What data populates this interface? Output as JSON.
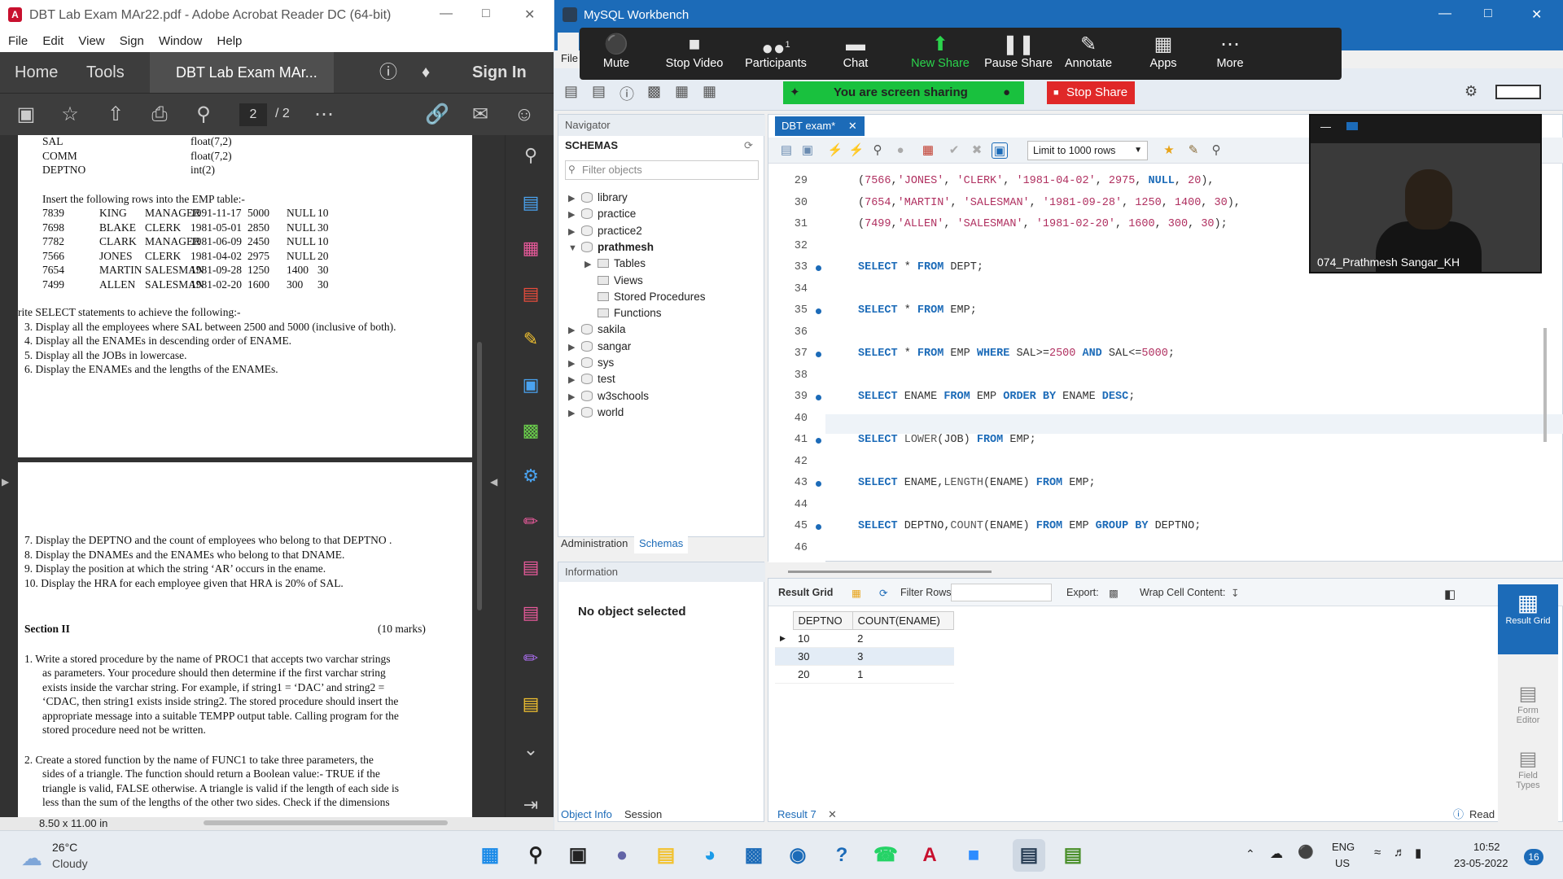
{
  "acrobat": {
    "title": "DBT Lab Exam MAr22.pdf - Adobe Acrobat Reader DC (64-bit)",
    "menu": [
      "File",
      "Edit",
      "View",
      "Sign",
      "Window",
      "Help"
    ],
    "home_tab": "Home",
    "tools_tab": "Tools",
    "doc_tab": "DBT Lab Exam MAr...",
    "sign_in": "Sign In",
    "page_current": "2",
    "page_total": "/ 2",
    "page_size": "8.50 x 11.00 in",
    "page1_fields": [
      {
        "name": "SAL",
        "type": "float(7,2)"
      },
      {
        "name": "COMM",
        "type": "float(7,2)"
      },
      {
        "name": "DEPTNO",
        "type": "int(2)"
      }
    ],
    "insert_heading": "Insert the following rows into the EMP table:-",
    "emp_rows": [
      [
        "7839",
        "KING",
        "MANAGER",
        "1991-11-17",
        "5000",
        "NULL",
        "10"
      ],
      [
        "7698",
        "BLAKE",
        "CLERK",
        "1981-05-01",
        "2850",
        "NULL",
        "30"
      ],
      [
        "7782",
        "CLARK",
        "MANAGER",
        "1981-06-09",
        "2450",
        "NULL",
        "10"
      ],
      [
        "7566",
        "JONES",
        "CLERK",
        "1981-04-02",
        "2975",
        "NULL",
        "20"
      ],
      [
        "7654",
        "MARTIN",
        "SALESMAN",
        "1981-09-28",
        "1250",
        "1400",
        "30"
      ],
      [
        "7499",
        "ALLEN",
        "SALESMAN",
        "1981-02-20",
        "1600",
        "300",
        "30"
      ]
    ],
    "select_heading": "rite SELECT statements to achieve the following:-",
    "questions_a": [
      "3.  Display all the employees where SAL between 2500 and 5000 (inclusive of both).",
      "4.  Display all the ENAMEs in descending order of ENAME.",
      "5.  Display all the JOBs in lowercase.",
      "6.  Display the ENAMEs and the lengths of the ENAMEs."
    ],
    "questions_b": [
      "7.  Display the DEPTNO and the count of employees who belong to that DEPTNO .",
      "8.  Display the DNAMEs and the ENAMEs who belong to that DNAME.",
      "9.  Display the position at which the string ‘AR’ occurs in the ename.",
      "10. Display the HRA for each employee given that HRA is 20% of SAL."
    ],
    "section_title": "Section II",
    "section_marks": "(10 marks)",
    "q1_lines": [
      "1.  Write a stored procedure by the name of PROC1 that accepts two varchar strings",
      "as parameters. Your procedure should then determine if the first varchar string",
      "exists inside the varchar string. For example, if string1 = ‘DAC’ and string2 =",
      "‘CDAC, then string1 exists inside string2.  The stored procedure should insert the",
      "appropriate message into a suitable TEMPP output table. Calling program for the",
      "stored procedure need not be written."
    ],
    "q2_lines": [
      "2.  Create a stored function by the name of FUNC1 to take three parameters, the",
      "sides of a triangle. The function should return a Boolean value:- TRUE if the",
      "triangle is valid, FALSE otherwise. A triangle is valid if the length of each side is",
      "less than the sum of the lengths of the other two sides. Check if the dimensions"
    ]
  },
  "workbench": {
    "title": "MySQL Workbench",
    "file_menu": "File",
    "navigator_label": "Navigator",
    "schemas_label": "SCHEMAS",
    "filter_placeholder": "Filter objects",
    "schemas_top": [
      "library",
      "practice",
      "practice2"
    ],
    "active_schema": "prathmesh",
    "active_children": [
      "Tables",
      "Views",
      "Stored Procedures",
      "Functions"
    ],
    "schemas_bottom": [
      "sakila",
      "sangar",
      "sys",
      "test",
      "w3schools",
      "world"
    ],
    "admin_tab": "Administration",
    "schemas_tab": "Schemas",
    "info_label": "Information",
    "no_object": "No object selected",
    "object_info_tab": "Object Info",
    "session_tab": "Session",
    "editor_tab": "DBT exam*",
    "limit_rows": "Limit to 1000 rows",
    "line_numbers": [
      "29",
      "30",
      "31",
      "32",
      "33",
      "34",
      "35",
      "36",
      "37",
      "38",
      "39",
      "40",
      "41",
      "42",
      "43",
      "44",
      "45",
      "46"
    ],
    "result_grid_label": "Result Grid",
    "filter_rows_label": "Filter Rows:",
    "export_label": "Export:",
    "wrap_label": "Wrap Cell Content:",
    "grid_headers": [
      "DEPTNO",
      "COUNT(ENAME)"
    ],
    "grid_rows": [
      [
        "10",
        "2"
      ],
      [
        "30",
        "3"
      ],
      [
        "20",
        "1"
      ]
    ],
    "side_result_grid": "Result Grid",
    "side_form_editor": "Form Editor",
    "side_field_types": "Field Types",
    "result_tab": "Result 7",
    "read_only": "Read Only"
  },
  "zoom": {
    "buttons": [
      "Mute",
      "Stop Video",
      "Participants",
      "Chat",
      "New Share",
      "Pause Share",
      "Annotate",
      "Apps",
      "More"
    ],
    "participant_count": "1",
    "sharing_text": "You are screen sharing",
    "stop_share": "Stop Share",
    "participant_name": "074_Prathmesh Sangar_KH"
  },
  "taskbar": {
    "temperature": "26°C",
    "weather": "Cloudy",
    "lang_1": "ENG",
    "lang_2": "US",
    "time": "10:52",
    "date": "23-05-2022",
    "notifications": "16"
  }
}
